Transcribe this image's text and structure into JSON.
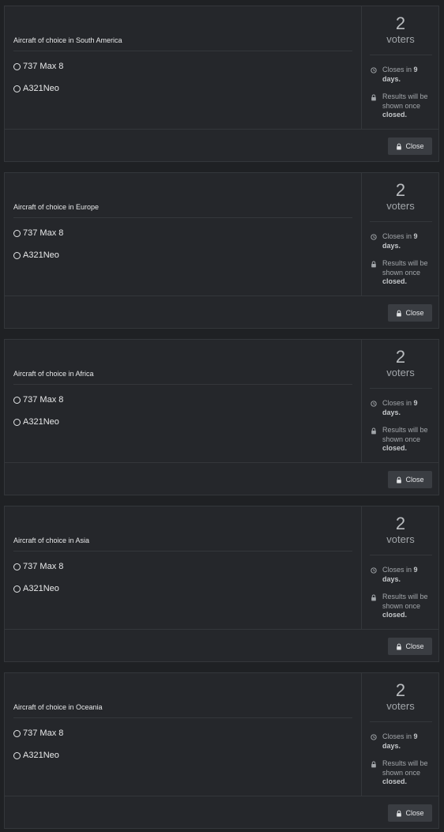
{
  "polls": [
    {
      "question": "Aircraft of choice in South America",
      "options": [
        "737 Max 8",
        "A321Neo"
      ],
      "voters_count": "2",
      "voters_label": "voters",
      "closes_prefix": "Closes in ",
      "closes_bold": "9 days.",
      "results_prefix": "Results will be shown once ",
      "results_bold": "closed.",
      "close_button_label": "Close"
    },
    {
      "question": "Aircraft of choice in Europe",
      "options": [
        "737 Max 8",
        "A321Neo"
      ],
      "voters_count": "2",
      "voters_label": "voters",
      "closes_prefix": "Closes in ",
      "closes_bold": "9 days.",
      "results_prefix": "Results will be shown once ",
      "results_bold": "closed.",
      "close_button_label": "Close"
    },
    {
      "question": "Aircraft of choice in Africa",
      "options": [
        "737 Max 8",
        "A321Neo"
      ],
      "voters_count": "2",
      "voters_label": "voters",
      "closes_prefix": "Closes in ",
      "closes_bold": "9 days.",
      "results_prefix": "Results will be shown once ",
      "results_bold": "closed.",
      "close_button_label": "Close"
    },
    {
      "question": "Aircraft of choice in Asia",
      "options": [
        "737 Max 8",
        "A321Neo"
      ],
      "voters_count": "2",
      "voters_label": "voters",
      "closes_prefix": "Closes in ",
      "closes_bold": "9 days.",
      "results_prefix": "Results will be shown once ",
      "results_bold": "closed.",
      "close_button_label": "Close"
    },
    {
      "question": "Aircraft of choice in Oceania",
      "options": [
        "737 Max 8",
        "A321Neo"
      ],
      "voters_count": "2",
      "voters_label": "voters",
      "closes_prefix": "Closes in ",
      "closes_bold": "9 days.",
      "results_prefix": "Results will be shown once ",
      "results_bold": "closed.",
      "close_button_label": "Close"
    }
  ],
  "icons": {
    "clock": "clock-icon",
    "lock": "lock-icon"
  },
  "colors": {
    "background": "#1f2124",
    "card": "#25272b",
    "border": "#34373b",
    "button": "#3a3d42",
    "muted_text": "#a2a6aa"
  }
}
